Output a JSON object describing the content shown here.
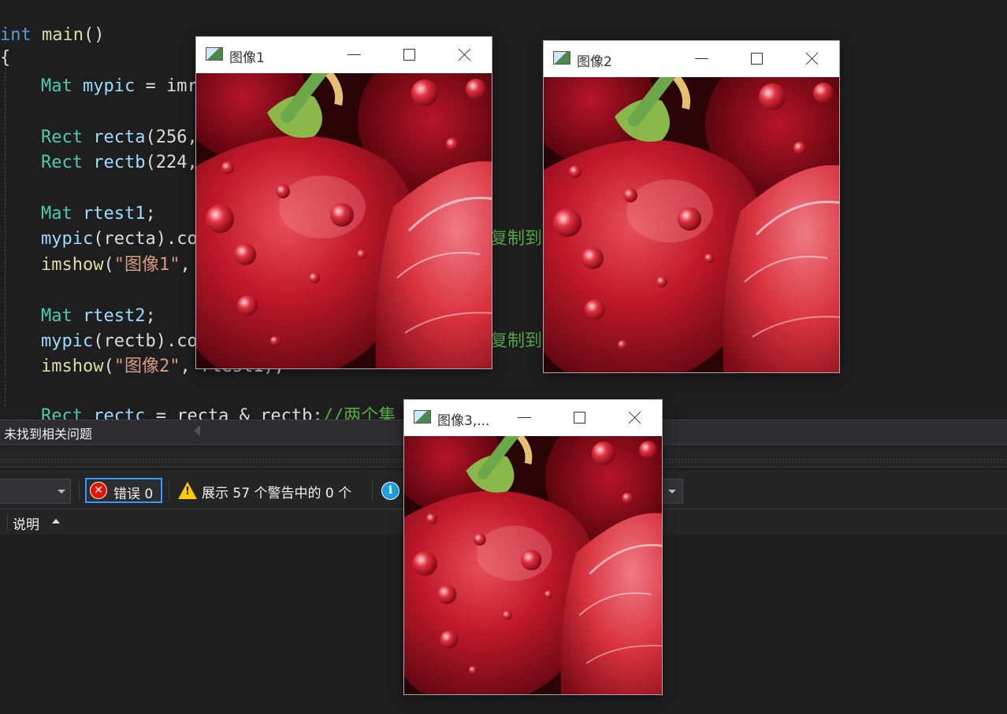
{
  "editor": {
    "lines": {
      "l1": {
        "kw": "int",
        "fn": "main",
        "rest": "()"
      },
      "l2": {
        "text": "{"
      },
      "l3": {
        "type": "Mat",
        "var": "mypic",
        "rest": " = imr"
      },
      "l4": {
        "type": "Rect",
        "var": "recta",
        "rest": "(256,"
      },
      "l5": {
        "type": "Rect",
        "var": "rectb",
        "rest": "(224,"
      },
      "l6": {
        "type": "Mat",
        "var": "rtest1",
        "rest": ";"
      },
      "l7": {
        "fn": "mypic",
        "rest": "(recta).co"
      },
      "l8": {
        "fn": "imshow",
        "pre": "(",
        "str": "\"图像1\"",
        "rest": ","
      },
      "l9": {
        "type": "Mat",
        "var": "rtest2",
        "rest": ";"
      },
      "l10": {
        "fn": "mypic",
        "rest": "(rectb).co"
      },
      "l11": {
        "fn": "imshow",
        "pre": "(",
        "str": "\"图像2\"",
        "rest": ", rtest1);"
      },
      "l12": {
        "type": "Rect",
        "var": "rectc",
        "rest": " = recta & rectb;",
        "comment": "//两个集"
      }
    },
    "right_comments": {
      "c1": "复制到",
      "c2": "复制到"
    }
  },
  "panel": {
    "status_text": "未找到相关问题",
    "errors_label": "错误 0",
    "warnings_label": "展示 57 个警告中的 0 个",
    "column_description": "说明"
  },
  "windows": {
    "w1": {
      "title": "图像1"
    },
    "w2": {
      "title": "图像2"
    },
    "w3": {
      "title": "图像3,..."
    }
  },
  "icons": {
    "error": "error-circle-icon",
    "warning": "warning-triangle-icon",
    "info": "info-circle-icon",
    "window": "image-window-icon"
  },
  "colors": {
    "editor_bg": "#1e1e1e",
    "keyword": "#569cd6",
    "type": "#4ec9b0",
    "string": "#d69d85",
    "comment": "#57a64a",
    "selected_border": "#3399ff"
  }
}
